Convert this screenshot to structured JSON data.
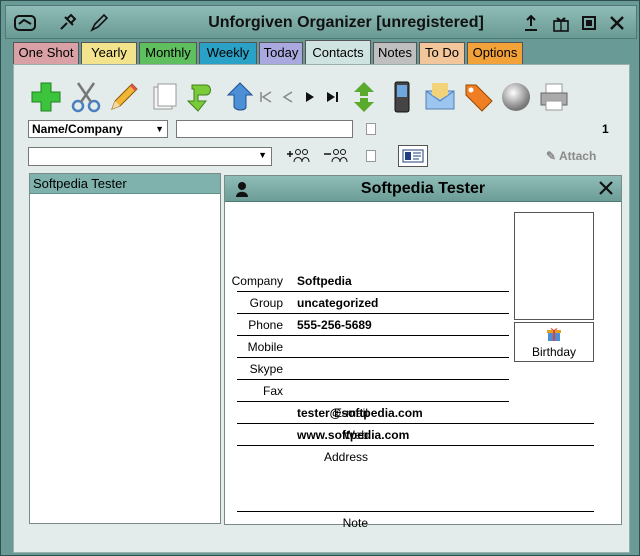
{
  "window": {
    "title": "Unforgiven Organizer [unregistered]"
  },
  "title_icons_left": [
    "logo-icon",
    "pin-icon",
    "pen-icon"
  ],
  "title_icons_right": [
    "upload-icon",
    "gift-icon",
    "maximize-icon",
    "close-icon"
  ],
  "tabs": [
    {
      "label": "One Shot",
      "color": "#d9a0a6"
    },
    {
      "label": "Yearly",
      "color": "#f3e38c"
    },
    {
      "label": "Monthly",
      "color": "#5fbf5f"
    },
    {
      "label": "Weekly",
      "color": "#2aa1c6"
    },
    {
      "label": "Today",
      "color": "#a9a9e0"
    },
    {
      "label": "Contacts",
      "color": "#cfe4e0"
    },
    {
      "label": "Notes",
      "color": "#bfbfbf"
    },
    {
      "label": "To Do",
      "color": "#f2c69a"
    },
    {
      "label": "Options",
      "color": "#f3a23a"
    }
  ],
  "active_tab": "Contacts",
  "toolbar": [
    "add-icon",
    "cut-icon",
    "edit-icon",
    "copy-icon",
    "move-down-icon",
    "move-up-icon",
    "first-icon",
    "prev-icon",
    "next-icon",
    "last-icon",
    "sort-icon",
    "phone-icon",
    "email-icon",
    "tag-icon",
    "globe-icon",
    "print-icon"
  ],
  "search": {
    "field": "Name/Company",
    "value": "",
    "count": "1"
  },
  "group_filter": {
    "value": ""
  },
  "attach_label": "Attach",
  "contacts": [
    {
      "name": "Softpedia Tester"
    }
  ],
  "detail": {
    "title": "Softpedia Tester",
    "fields": [
      {
        "label": "Company",
        "value": "Softpedia"
      },
      {
        "label": "Group",
        "value": "uncategorized"
      },
      {
        "label": "Phone",
        "value": "555-256-5689"
      },
      {
        "label": "Mobile",
        "value": ""
      },
      {
        "label": "Skype",
        "value": ""
      },
      {
        "label": "Fax",
        "value": ""
      },
      {
        "label": "E-mail",
        "value": "tester@softpedia.com"
      },
      {
        "label": "Web",
        "value": "www.softpedia.com"
      },
      {
        "label": "Address",
        "value": ""
      },
      {
        "label": "Note",
        "value": ""
      }
    ],
    "birthday_label": "Birthday"
  }
}
